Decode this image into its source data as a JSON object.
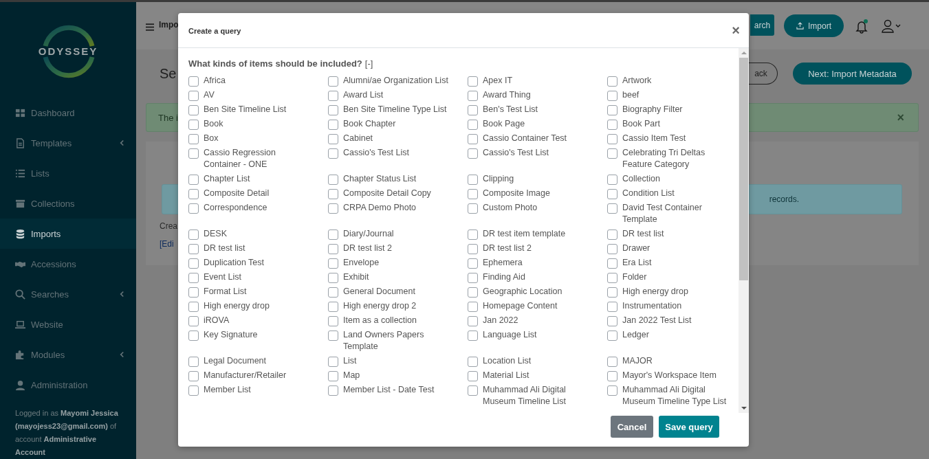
{
  "sidebar": {
    "logo": "ODYSSEY",
    "items": [
      {
        "label": "Dashboard",
        "selected": false,
        "has_submenu": false
      },
      {
        "label": "Templates",
        "selected": false,
        "has_submenu": true
      },
      {
        "label": "Lists",
        "selected": false,
        "has_submenu": false
      },
      {
        "label": "Collections",
        "selected": false,
        "has_submenu": false
      },
      {
        "label": "Imports",
        "selected": true,
        "has_submenu": false
      },
      {
        "label": "Accessions",
        "selected": false,
        "has_submenu": false
      },
      {
        "label": "Searches",
        "selected": false,
        "has_submenu": true
      },
      {
        "label": "Website",
        "selected": false,
        "has_submenu": false
      },
      {
        "label": "Modules",
        "selected": false,
        "has_submenu": true
      },
      {
        "label": "Administration",
        "selected": false,
        "has_submenu": false
      }
    ],
    "login_note": "Logged in as **Mayomi Jessica** **(mayojess23@gmail.com)** of account **Administrative Account**"
  },
  "header": {
    "title": "Impo",
    "search_button": "arch",
    "import_button": "Import",
    "notification_dot": true
  },
  "page": {
    "title": "Se",
    "back_button": "ack",
    "next_button": "Next: Import Metadata",
    "alert": "The i",
    "alert_close": "×",
    "info": "records.",
    "created_text": "Crea",
    "edit_link": "[Edi"
  },
  "modal": {
    "title": "Create a query",
    "close": "×",
    "question": "What kinds of items should be included?",
    "collapse": "[-]",
    "options": [
      {
        "label": "Africa",
        "checked": false
      },
      {
        "label": "Alumni/ae Organization List",
        "checked": false
      },
      {
        "label": "Apex IT",
        "checked": false
      },
      {
        "label": "Artwork",
        "checked": false
      },
      {
        "label": "AV",
        "checked": false
      },
      {
        "label": "Award List",
        "checked": false
      },
      {
        "label": "Award Thing",
        "checked": false
      },
      {
        "label": "beef",
        "checked": false
      },
      {
        "label": "Ben Site Timeline List",
        "checked": false
      },
      {
        "label": "Ben Site Timeline Type List",
        "checked": false
      },
      {
        "label": "Ben's Test List",
        "checked": false
      },
      {
        "label": "Biography Filter",
        "checked": false
      },
      {
        "label": "Book",
        "checked": false
      },
      {
        "label": "Book Chapter",
        "checked": false
      },
      {
        "label": "Book Page",
        "checked": false
      },
      {
        "label": "Book Part",
        "checked": false
      },
      {
        "label": "Box",
        "checked": false
      },
      {
        "label": "Cabinet",
        "checked": false
      },
      {
        "label": "Cassio Container Test",
        "checked": false
      },
      {
        "label": "Cassio Item Test",
        "checked": false
      },
      {
        "label": "Cassio Regression Container - ONE",
        "checked": false
      },
      {
        "label": "Cassio's Test List",
        "checked": false
      },
      {
        "label": "Cassio's Test List",
        "checked": false
      },
      {
        "label": "Celebrating Tri Deltas Feature Category",
        "checked": false
      },
      {
        "label": "Chapter List",
        "checked": false
      },
      {
        "label": "Chapter Status List",
        "checked": false
      },
      {
        "label": "Clipping",
        "checked": false
      },
      {
        "label": "Collection",
        "checked": false
      },
      {
        "label": "Composite Detail",
        "checked": false
      },
      {
        "label": "Composite Detail Copy",
        "checked": false
      },
      {
        "label": "Composite Image",
        "checked": false
      },
      {
        "label": "Condition List",
        "checked": false
      },
      {
        "label": "Correspondence",
        "checked": false
      },
      {
        "label": "CRPA Demo Photo",
        "checked": false
      },
      {
        "label": "Custom Photo",
        "checked": false
      },
      {
        "label": "David Test Container Template",
        "checked": false
      },
      {
        "label": "DESK",
        "checked": false
      },
      {
        "label": "Diary/Journal",
        "checked": false
      },
      {
        "label": "DR test item template",
        "checked": false
      },
      {
        "label": "DR test list",
        "checked": false
      },
      {
        "label": "DR test list",
        "checked": false
      },
      {
        "label": "DR test list 2",
        "checked": false
      },
      {
        "label": "DR test list 2",
        "checked": false
      },
      {
        "label": "Drawer",
        "checked": false
      },
      {
        "label": "Duplication Test",
        "checked": false
      },
      {
        "label": "Envelope",
        "checked": false
      },
      {
        "label": "Ephemera",
        "checked": false
      },
      {
        "label": "Era List",
        "checked": false
      },
      {
        "label": "Event List",
        "checked": false
      },
      {
        "label": "Exhibit",
        "checked": false
      },
      {
        "label": "Finding Aid",
        "checked": false
      },
      {
        "label": "Folder",
        "checked": false
      },
      {
        "label": "Format List",
        "checked": false
      },
      {
        "label": "General Document",
        "checked": false
      },
      {
        "label": "Geographic Location",
        "checked": false
      },
      {
        "label": "High energy drop",
        "checked": false
      },
      {
        "label": "High energy drop",
        "checked": false
      },
      {
        "label": "High energy drop 2",
        "checked": false
      },
      {
        "label": "Homepage Content",
        "checked": false
      },
      {
        "label": "Instrumentation",
        "checked": false
      },
      {
        "label": "iROVA",
        "checked": false
      },
      {
        "label": "Item as a collection",
        "checked": false
      },
      {
        "label": "Jan 2022",
        "checked": false
      },
      {
        "label": "Jan 2022 Test List",
        "checked": false
      },
      {
        "label": "Key Signature",
        "checked": false
      },
      {
        "label": "Land Owners Papers Template",
        "checked": false
      },
      {
        "label": "Language List",
        "checked": false
      },
      {
        "label": "Ledger",
        "checked": false
      },
      {
        "label": "Legal Document",
        "checked": false
      },
      {
        "label": "List",
        "checked": false
      },
      {
        "label": "Location List",
        "checked": false
      },
      {
        "label": "MAJOR",
        "checked": false
      },
      {
        "label": "Manufacturer/Retailer",
        "checked": false
      },
      {
        "label": "Map",
        "checked": false
      },
      {
        "label": "Material List",
        "checked": false
      },
      {
        "label": "Mayor's Workspace Item",
        "checked": false
      },
      {
        "label": "Member List",
        "checked": false
      },
      {
        "label": "Member List - Date Test",
        "checked": false
      },
      {
        "label": "Muhammad Ali Digital Museum Timeline List",
        "checked": false
      },
      {
        "label": "Muhammad Ali Digital Museum Timeline Type List",
        "checked": false
      }
    ],
    "buttons": [
      {
        "label": "Cancel",
        "kind": "secondary"
      },
      {
        "label": "Save query",
        "kind": "primary"
      }
    ]
  }
}
